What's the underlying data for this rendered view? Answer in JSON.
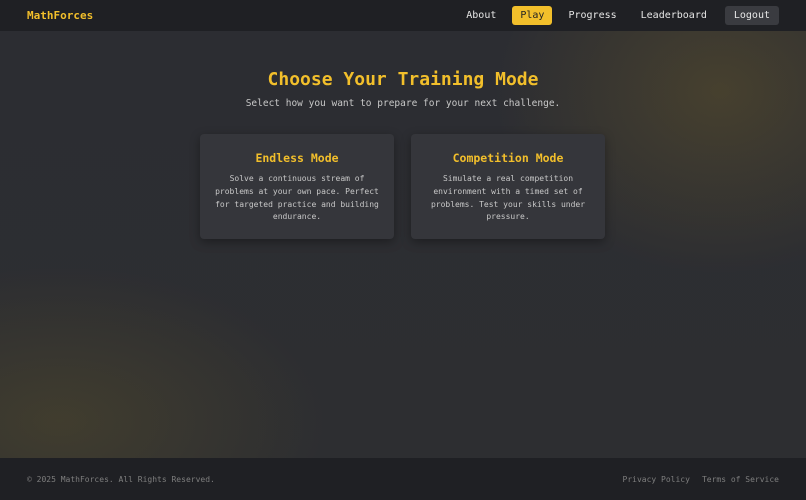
{
  "navbar": {
    "brand": "MathForces",
    "items": [
      {
        "label": "About"
      },
      {
        "label": "Play",
        "active": true
      },
      {
        "label": "Progress"
      },
      {
        "label": "Leaderboard"
      },
      {
        "label": "Logout"
      }
    ],
    "accent_color": "#f2bf2b"
  },
  "main": {
    "title": "Choose Your Training Mode",
    "subtitle": "Select how you want to prepare for your next challenge.",
    "cards": [
      {
        "title": "Endless Mode",
        "description": "Solve a continuous stream of problems at your own pace. Perfect for targeted practice and building endurance."
      },
      {
        "title": "Competition Mode",
        "description": "Simulate a real competition environment with a timed set of problems. Test your skills under pressure."
      }
    ]
  },
  "footer": {
    "copyright": "© 2025 MathForces. All Rights Reserved.",
    "links": [
      "Privacy Policy",
      "Terms of Service"
    ]
  }
}
